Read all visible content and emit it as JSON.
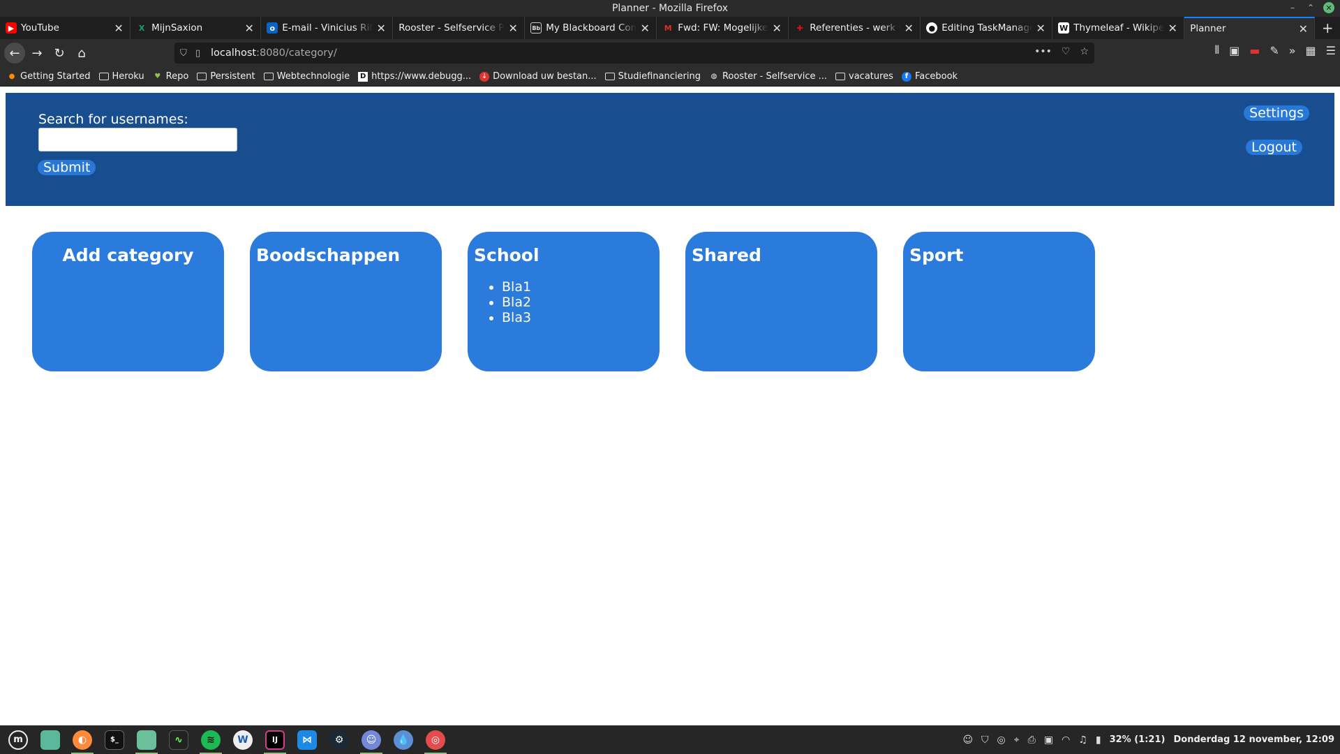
{
  "window": {
    "title": "Planner - Mozilla Firefox"
  },
  "tabs": [
    {
      "label": "YouTube",
      "icon": "youtube-icon",
      "color": "#ff0000"
    },
    {
      "label": "MijnSaxion",
      "icon": "saxion-icon",
      "color": "#1b9e77"
    },
    {
      "label": "E-mail - Vinicius Ribeiro",
      "icon": "outlook-icon",
      "color": "#0a64c8"
    },
    {
      "label": "Rooster - Selfservice Portal",
      "icon": "",
      "color": ""
    },
    {
      "label": "My Blackboard Content",
      "icon": "blackboard-icon",
      "color": "#444444"
    },
    {
      "label": "Fwd: FW: Mogelijke opdracht",
      "icon": "gmail-icon",
      "color": "#d93025"
    },
    {
      "label": "Referenties - werk waar",
      "icon": "referenties-icon",
      "color": "#d40e1a"
    },
    {
      "label": "Editing TaskManager",
      "icon": "github-icon",
      "color": "#ffffff"
    },
    {
      "label": "Thymeleaf - Wikipedia",
      "icon": "wikipedia-icon",
      "color": "#ffffff"
    },
    {
      "label": "Planner",
      "icon": "",
      "color": ""
    }
  ],
  "url": {
    "host": "localhost",
    "path": ":8080/category/"
  },
  "bookmarks": [
    {
      "label": "Getting Started",
      "icon": "firefox-icon"
    },
    {
      "label": "Heroku",
      "icon": "folder-icon"
    },
    {
      "label": "Repo",
      "icon": "android-icon"
    },
    {
      "label": "Persistent",
      "icon": "folder-icon"
    },
    {
      "label": "Webtechnologie",
      "icon": "folder-icon"
    },
    {
      "label": "https://www.debugg...",
      "icon": "debuggex-icon"
    },
    {
      "label": "Download uw bestan...",
      "icon": "download-icon"
    },
    {
      "label": "Studiefinanciering",
      "icon": "folder-icon"
    },
    {
      "label": "Rooster - Selfservice ...",
      "icon": "globe-icon"
    },
    {
      "label": "vacatures",
      "icon": "folder-icon"
    },
    {
      "label": "Facebook",
      "icon": "facebook-icon"
    }
  ],
  "header": {
    "search_label": "Search for usernames:",
    "search_value": "",
    "submit_label": "Submit",
    "settings_label": "Settings",
    "logout_label": "Logout"
  },
  "categories": [
    {
      "title": "Add category",
      "items": []
    },
    {
      "title": "Boodschappen",
      "items": []
    },
    {
      "title": "School",
      "items": [
        "Bla1",
        "Bla2",
        "Bla3"
      ]
    },
    {
      "title": "Shared",
      "items": []
    },
    {
      "title": "Sport",
      "items": []
    }
  ],
  "tray": {
    "battery": "32% (1:21)",
    "datetime": "Donderdag 12 november, 12:09"
  },
  "colors": {
    "header_bg": "#184e90",
    "card_bg": "#2a7bdb",
    "pill_bg": "#2878d8"
  }
}
